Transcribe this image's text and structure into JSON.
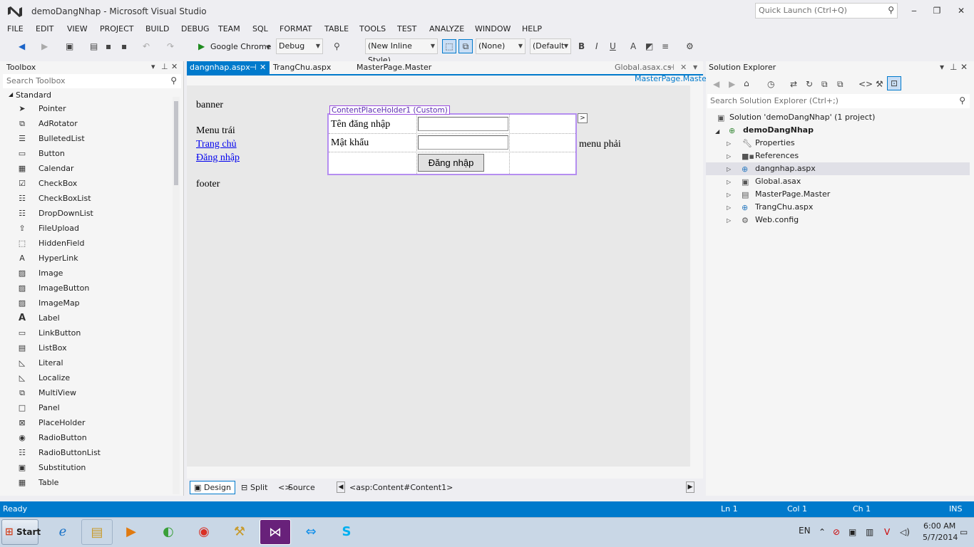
{
  "window": {
    "title": "demoDangNhap - Microsoft Visual Studio",
    "quick_launch_placeholder": "Quick Launch (Ctrl+Q)"
  },
  "menu": [
    "FILE",
    "EDIT",
    "VIEW",
    "PROJECT",
    "BUILD",
    "DEBUG",
    "TEAM",
    "SQL",
    "FORMAT",
    "TABLE",
    "TOOLS",
    "TEST",
    "ANALYZE",
    "WINDOW",
    "HELP"
  ],
  "toolbar": {
    "browser": "Google Chrome",
    "config": "Debug",
    "style": "(New Inline Style)",
    "target": "(None)",
    "font": "(Default"
  },
  "toolbox": {
    "title": "Toolbox",
    "search_placeholder": "Search Toolbox",
    "group": "Standard",
    "items": [
      "Pointer",
      "AdRotator",
      "BulletedList",
      "Button",
      "Calendar",
      "CheckBox",
      "CheckBoxList",
      "DropDownList",
      "FileUpload",
      "HiddenField",
      "HyperLink",
      "Image",
      "ImageButton",
      "ImageMap",
      "Label",
      "LinkButton",
      "ListBox",
      "Literal",
      "Localize",
      "MultiView",
      "Panel",
      "PlaceHolder",
      "RadioButton",
      "RadioButtonList",
      "Substitution",
      "Table"
    ]
  },
  "editor": {
    "tabs": [
      "dangnhap.aspx",
      "TrangChu.aspx",
      "MasterPage.Master",
      "Global.asax.cs"
    ],
    "master_link": "MasterPage.Master",
    "page": {
      "banner": "banner",
      "menu_left": "Menu trái",
      "link_home": "Trang chủ",
      "link_login": "Đăng nhập",
      "footer": "footer",
      "menu_right": "menu phải",
      "placeholder_label": "ContentPlaceHolder1 (Custom)",
      "username_label": "Tên đăng nhập",
      "password_label": "Mật khẩu",
      "login_button": "Đăng nhập"
    },
    "views": {
      "design": "Design",
      "split": "Split",
      "source": "Source",
      "breadcrumb": "<asp:Content#Content1>"
    }
  },
  "solution_explorer": {
    "title": "Solution Explorer",
    "search_placeholder": "Search Solution Explorer (Ctrl+;)",
    "solution": "Solution 'demoDangNhap' (1 project)",
    "project": "demoDangNhap",
    "items": [
      "Properties",
      "References",
      "dangnhap.aspx",
      "Global.asax",
      "MasterPage.Master",
      "TrangChu.aspx",
      "Web.config"
    ]
  },
  "status": {
    "state": "Ready",
    "ln": "Ln 1",
    "col": "Col 1",
    "ch": "Ch 1",
    "mode": "INS"
  },
  "taskbar": {
    "start": "Start",
    "lang": "EN",
    "time": "6:00 AM",
    "date": "5/7/2014"
  }
}
